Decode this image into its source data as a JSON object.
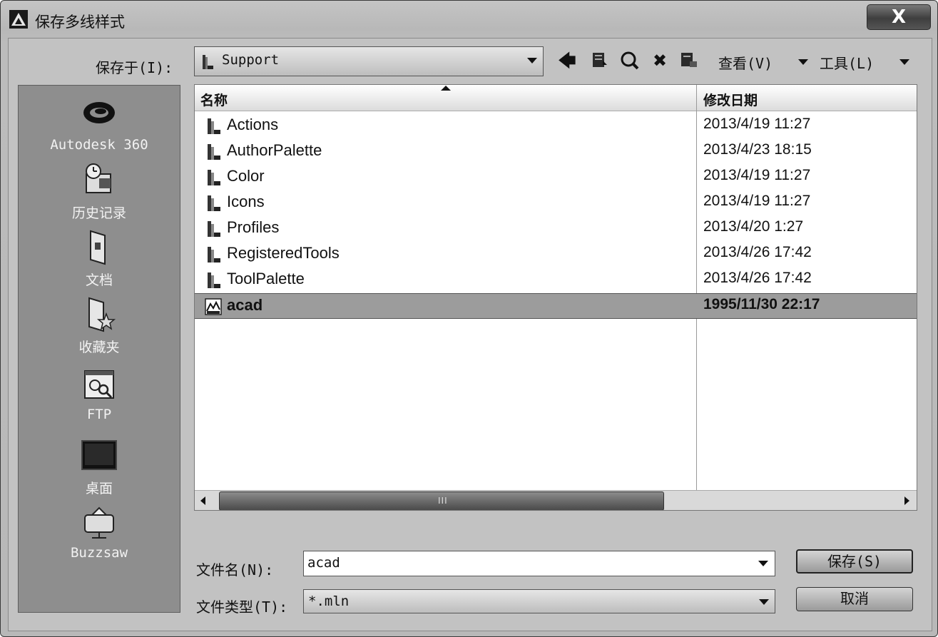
{
  "window": {
    "title": "保存多线样式",
    "close_label": "X"
  },
  "toolbar": {
    "save_in_label": "保存于(I):",
    "location": "Support",
    "view_label": "查看(V)",
    "tools_label": "工具(L)"
  },
  "places": [
    {
      "label": "Autodesk 360",
      "icon": "autodesk-360-icon"
    },
    {
      "label": "历史记录",
      "icon": "history-icon"
    },
    {
      "label": "文档",
      "icon": "documents-icon"
    },
    {
      "label": "收藏夹",
      "icon": "favorites-icon"
    },
    {
      "label": "FTP",
      "icon": "ftp-icon"
    },
    {
      "label": "桌面",
      "icon": "desktop-icon"
    },
    {
      "label": "Buzzsaw",
      "icon": "buzzsaw-icon"
    }
  ],
  "filelist": {
    "columns": [
      "名称",
      "修改日期"
    ],
    "rows": [
      {
        "name": "Actions",
        "date": "2013/4/19 11:27",
        "type": "folder"
      },
      {
        "name": "AuthorPalette",
        "date": "2013/4/23 18:15",
        "type": "folder"
      },
      {
        "name": "Color",
        "date": "2013/4/19 11:27",
        "type": "folder"
      },
      {
        "name": "Icons",
        "date": "2013/4/19 11:27",
        "type": "folder"
      },
      {
        "name": "Profiles",
        "date": "2013/4/20 1:27",
        "type": "folder"
      },
      {
        "name": "RegisteredTools",
        "date": "2013/4/26 17:42",
        "type": "folder"
      },
      {
        "name": "ToolPalette",
        "date": "2013/4/26 17:42",
        "type": "folder"
      },
      {
        "name": "acad",
        "date": "1995/11/30 22:17",
        "type": "mln-file",
        "selected": true
      }
    ],
    "scroll_grip": "III"
  },
  "form": {
    "filename_label": "文件名(N):",
    "filename_value": "acad",
    "filetype_label": "文件类型(T):",
    "filetype_value": "*.mln",
    "save_button": "保存(S)",
    "cancel_button": "取消"
  }
}
